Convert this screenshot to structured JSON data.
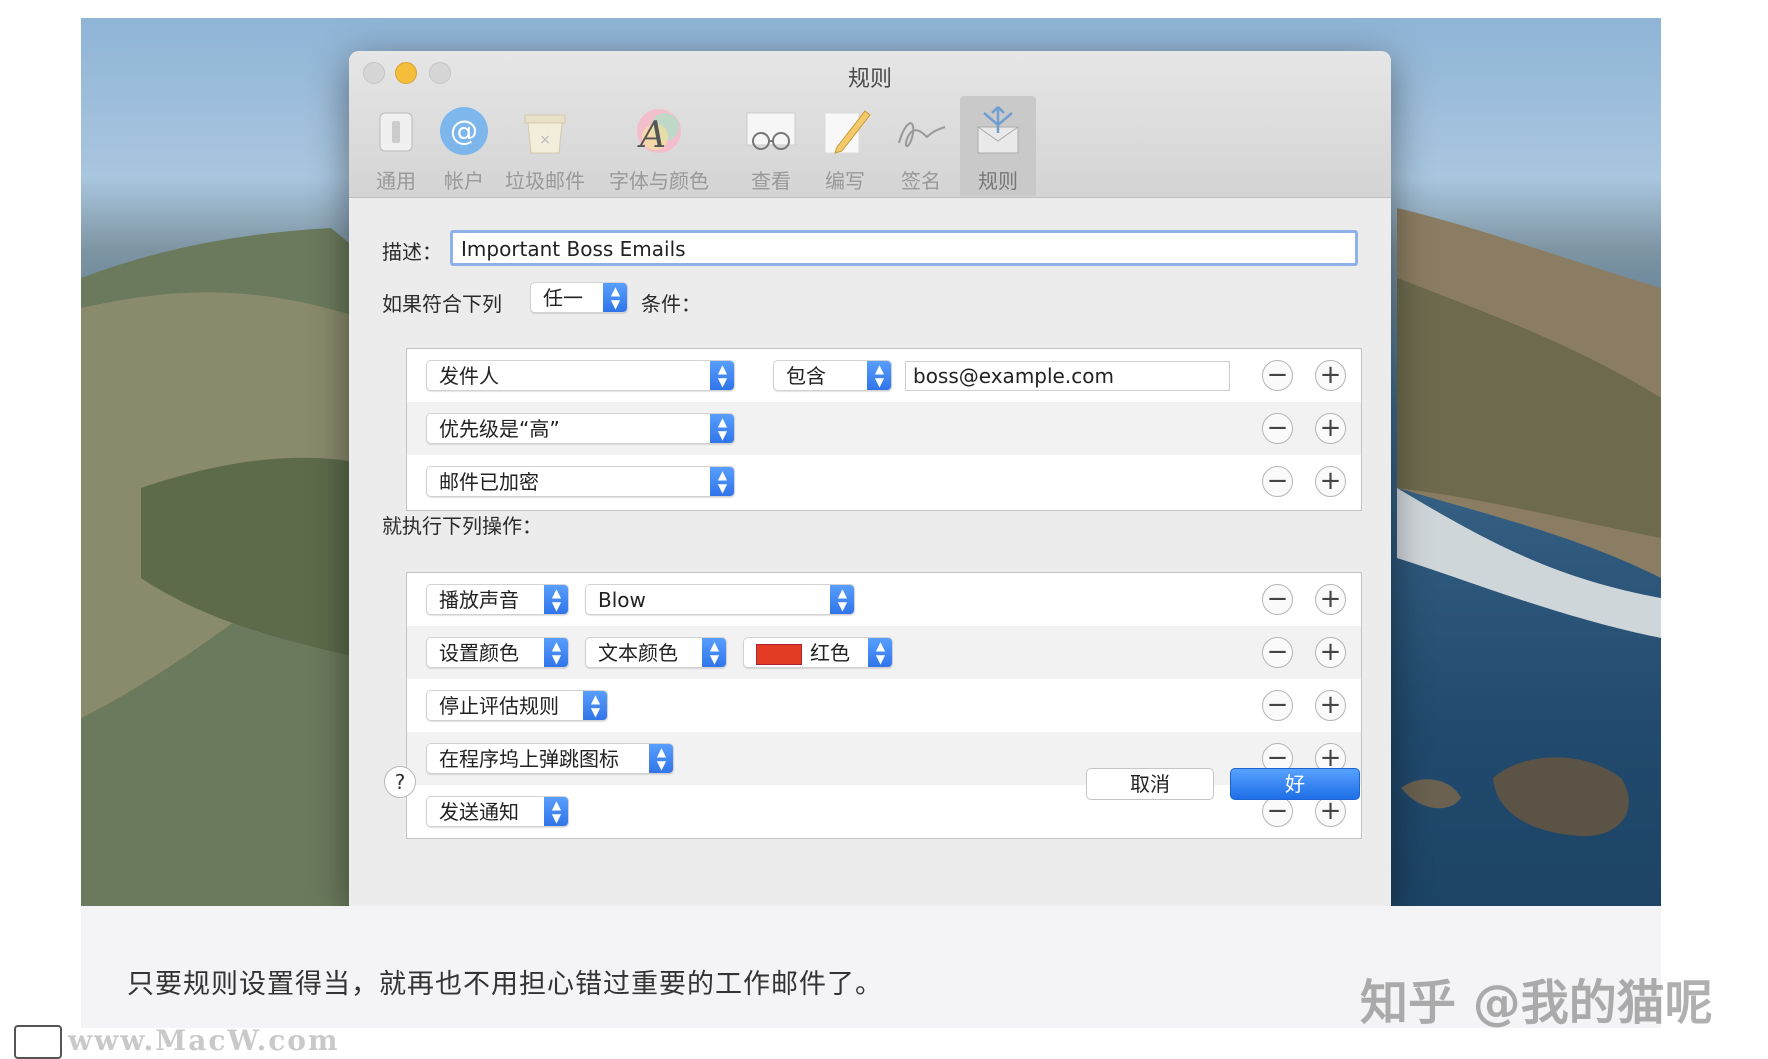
{
  "window": {
    "title": "规则"
  },
  "toolbar": {
    "items": [
      {
        "label": "通用",
        "icon": "switch-icon"
      },
      {
        "label": "帐户",
        "icon": "at-sign-icon"
      },
      {
        "label": "垃圾邮件",
        "icon": "junk-mail-icon"
      },
      {
        "label": "字体与颜色",
        "icon": "fonts-colors-icon"
      },
      {
        "label": "查看",
        "icon": "glasses-icon"
      },
      {
        "label": "编写",
        "icon": "pencil-icon"
      },
      {
        "label": "签名",
        "icon": "signature-icon"
      },
      {
        "label": "规则",
        "icon": "rules-envelope-icon",
        "selected": true
      }
    ]
  },
  "form": {
    "description_label": "描述：",
    "description_value": "Important Boss Emails",
    "if_label": "如果符合下列",
    "match_selected": "任一",
    "conditions_label": "条件：",
    "conditions": [
      {
        "field": "发件人",
        "operator": "包含",
        "value": "boss@example.com"
      },
      {
        "field": "优先级是“高”"
      },
      {
        "field": "邮件已加密"
      }
    ],
    "actions_label": "就执行下列操作：",
    "actions": [
      {
        "action": "播放声音",
        "param": "Blow"
      },
      {
        "action": "设置颜色",
        "param": "文本颜色",
        "color_name": "红色",
        "color_hex": "#e33b24"
      },
      {
        "action": "停止评估规则"
      },
      {
        "action": "在程序坞上弹跳图标"
      },
      {
        "action": "发送通知"
      }
    ],
    "minus": "−",
    "plus": "+",
    "help": "?",
    "cancel": "取消",
    "ok": "好"
  },
  "caption": "只要规则设置得当，就再也不用担心错过重要的工作邮件了。",
  "watermark": "知乎 @我的猫呢",
  "site_watermark": "www.MacW.com",
  "colors": {
    "accent": "#2f73e8",
    "close": "#d7d7d7",
    "minimize": "#f4bd3a",
    "zoom": "#d7d7d7"
  }
}
